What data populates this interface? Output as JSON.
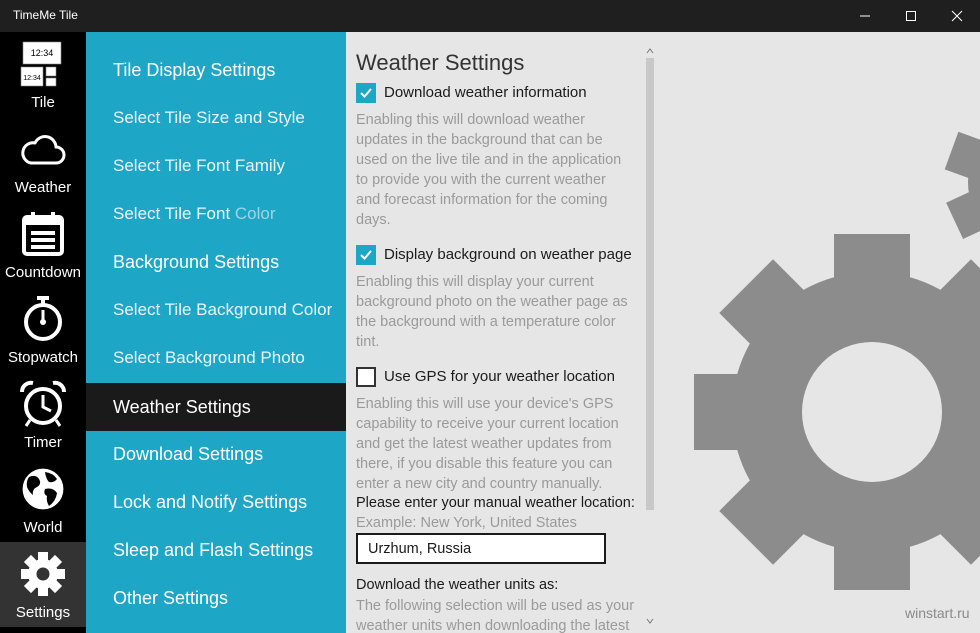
{
  "window": {
    "title": "TimeMe Tile",
    "minimize_icon": "minimize-icon",
    "maximize_icon": "maximize-icon",
    "close_icon": "close-icon"
  },
  "nav": [
    {
      "label": "Tile",
      "icon": "tile-icon",
      "clock1": "12:34",
      "clock2": "12:34"
    },
    {
      "label": "Weather",
      "icon": "cloud-icon"
    },
    {
      "label": "Countdown",
      "icon": "calendar-icon"
    },
    {
      "label": "Stopwatch",
      "icon": "stopwatch-icon"
    },
    {
      "label": "Timer",
      "icon": "alarm-clock-icon"
    },
    {
      "label": "World",
      "icon": "globe-icon"
    },
    {
      "label": "Settings",
      "icon": "gear-icon",
      "active": true
    }
  ],
  "menu": {
    "items": [
      {
        "label": "Tile Display Settings",
        "type": "header"
      },
      {
        "label": "Select Tile Size and Style",
        "type": "sub"
      },
      {
        "label": "Select Tile Font Family",
        "type": "sub"
      },
      {
        "label_a": "Select Tile Font ",
        "label_b": "Color",
        "type": "sub"
      },
      {
        "label": "Background Settings",
        "type": "header"
      },
      {
        "label": "Select Tile Background Color",
        "type": "sub"
      },
      {
        "label": "Select Background Photo",
        "type": "sub"
      },
      {
        "label": "Weather Settings",
        "type": "header",
        "selected": true
      },
      {
        "label": "Download Settings",
        "type": "header"
      },
      {
        "label": "Lock and Notify Settings",
        "type": "header"
      },
      {
        "label": "Sleep and Flash Settings",
        "type": "header"
      },
      {
        "label": "Other Settings",
        "type": "header"
      }
    ]
  },
  "content": {
    "title": "Weather Settings",
    "opt1": {
      "label": "Download weather information",
      "checked": true,
      "desc": [
        "Enabling this will download weather",
        "updates in the background that can be",
        "used on the live tile and in the application",
        "to provide you with the current weather",
        "and forecast information for the coming",
        "days."
      ]
    },
    "opt2": {
      "label": "Display background on weather page",
      "checked": true,
      "desc": [
        "Enabling this will display your current",
        "background photo on the weather page as",
        "the background with a temperature color",
        "tint."
      ]
    },
    "opt3": {
      "label": "Use GPS for your weather location",
      "checked": false,
      "desc": [
        "Enabling this will use your device's GPS",
        "capability to receive your current location",
        "and get the latest weather updates from",
        "there, if you disable this feature you can",
        "enter a new city and country manually."
      ]
    },
    "location_prompt": "Please enter your manual weather location:",
    "location_hint": "Example: New York, United States",
    "location_value": "Urzhum, Russia",
    "units_prompt": "Download the weather units as:",
    "units_desc": [
      "The following selection will be used as your",
      "weather units when downloading the latest"
    ]
  },
  "watermark": "winstart.ru",
  "colors": {
    "accent": "#1ea6c6",
    "nav_bg": "#000000",
    "selected": "#1a1a1a",
    "gear": "#8c8c8c"
  }
}
